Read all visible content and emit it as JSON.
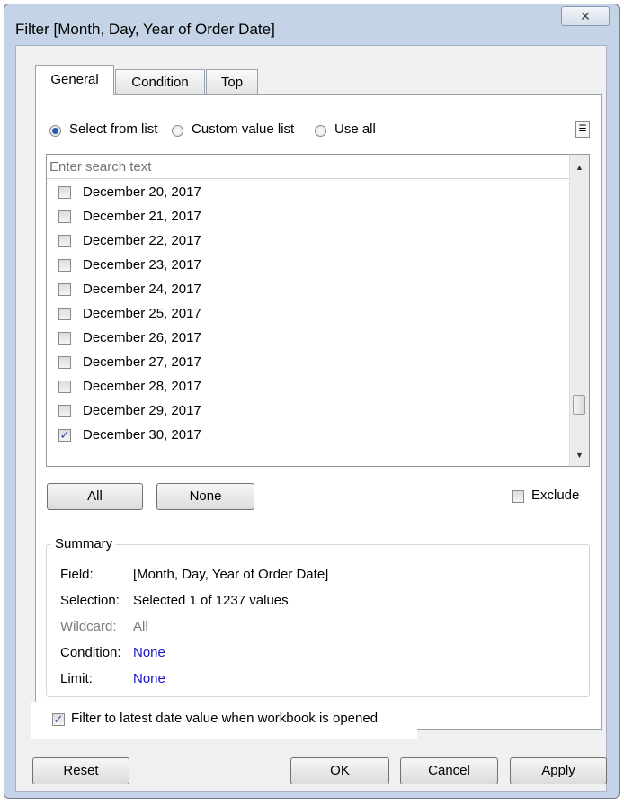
{
  "window": {
    "title": "Filter [Month, Day, Year of Order Date]",
    "close_glyph": "✕"
  },
  "tabs": [
    {
      "label": "General"
    },
    {
      "label": "Condition"
    },
    {
      "label": "Top"
    }
  ],
  "selection_mode": {
    "options": [
      {
        "label": "Select from list",
        "selected": true
      },
      {
        "label": "Custom value list",
        "selected": false
      },
      {
        "label": "Use all",
        "selected": false
      }
    ],
    "menu_icon": "list-menu-icon"
  },
  "search": {
    "placeholder": "Enter search text",
    "value": ""
  },
  "list": {
    "items": [
      {
        "label": "December 20, 2017",
        "checked": false
      },
      {
        "label": "December 21, 2017",
        "checked": false
      },
      {
        "label": "December 22, 2017",
        "checked": false
      },
      {
        "label": "December 23, 2017",
        "checked": false
      },
      {
        "label": "December 24, 2017",
        "checked": false
      },
      {
        "label": "December 25, 2017",
        "checked": false
      },
      {
        "label": "December 26, 2017",
        "checked": false
      },
      {
        "label": "December 27, 2017",
        "checked": false
      },
      {
        "label": "December 28, 2017",
        "checked": false
      },
      {
        "label": "December 29, 2017",
        "checked": false
      },
      {
        "label": "December 30, 2017",
        "checked": true
      }
    ]
  },
  "list_buttons": {
    "all_label": "All",
    "none_label": "None"
  },
  "exclude": {
    "label": "Exclude",
    "checked": false
  },
  "summary": {
    "title": "Summary",
    "field_key": "Field:",
    "field_value": "[Month, Day, Year of Order Date]",
    "selection_key": "Selection:",
    "selection_value": "Selected 1 of 1237 values",
    "wildcard_key": "Wildcard:",
    "wildcard_value": "All",
    "condition_key": "Condition:",
    "condition_value": "None",
    "limit_key": "Limit:",
    "limit_value": "None"
  },
  "latest_date": {
    "label": "Filter to latest date value when workbook is opened",
    "checked": true
  },
  "footer": {
    "reset_label": "Reset",
    "ok_label": "OK",
    "cancel_label": "Cancel",
    "apply_label": "Apply"
  },
  "colors": {
    "link": "#1616c8",
    "disabled": "#7a7a7a",
    "frame": "#c4d4e6"
  }
}
